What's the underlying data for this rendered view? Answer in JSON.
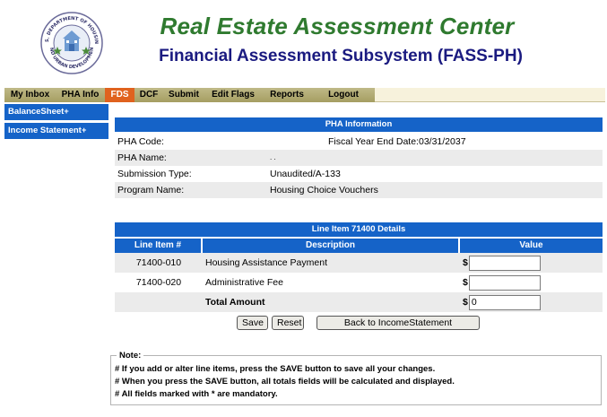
{
  "header": {
    "title": "Real Estate Assessment Center",
    "subtitle": "Financial Assessment Subsystem (FASS-PH)",
    "seal_top_text": "U.S. DEPARTMENT OF HOUSING",
    "seal_bottom_text": "AND URBAN DEVELOPMENT"
  },
  "nav": {
    "items": [
      {
        "label": "My Inbox",
        "active": false
      },
      {
        "label": "PHA Info",
        "active": false
      },
      {
        "label": "FDS",
        "active": true
      },
      {
        "label": "DCF",
        "active": false
      },
      {
        "label": "Submit",
        "active": false
      },
      {
        "label": "Edit Flags",
        "active": false
      },
      {
        "label": "Reports",
        "active": false
      },
      {
        "label": "Logout",
        "active": false
      }
    ]
  },
  "sidebar": {
    "items": [
      {
        "label": "BalanceSheet+"
      },
      {
        "label": "Income Statement+"
      }
    ]
  },
  "pha_info": {
    "title": "PHA Information",
    "code_label": "PHA Code:",
    "code_value": "",
    "fiscal_year_label": "Fiscal Year End Date:",
    "fiscal_year_value": "03/31/2037",
    "name_label": "PHA Name:",
    "name_value": ". .",
    "submission_type_label": "Submission Type:",
    "submission_type_value": "Unaudited/A-133",
    "program_name_label": "Program Name:",
    "program_name_value": "Housing Choice Vouchers"
  },
  "line_item": {
    "title": "Line Item 71400 Details",
    "columns": [
      "Line Item #",
      "Description",
      "Value"
    ],
    "rows": [
      {
        "number": "71400-010",
        "description": "Housing Assistance Payment",
        "currency": "$",
        "value": ""
      },
      {
        "number": "71400-020",
        "description": "Administrative Fee",
        "currency": "$",
        "value": ""
      }
    ],
    "total_label": "Total Amount",
    "total_currency": "$",
    "total_value": "0",
    "buttons": {
      "save": "Save",
      "reset": "Reset",
      "back": "Back to IncomeStatement"
    }
  },
  "note": {
    "title": "Note:",
    "lines": [
      "# If you add or alter line items, press the SAVE button to save all your changes.",
      "# When you press the SAVE button, all totals fields will be calculated and displayed.",
      "# All fields marked with * are mandatory."
    ]
  },
  "colors": {
    "title_green": "#2f7a2f",
    "subtitle_navy": "#1a1a80",
    "nav_active": "#e0621e",
    "panel_blue": "#1563c8",
    "nav_olive": "#bfb987"
  }
}
